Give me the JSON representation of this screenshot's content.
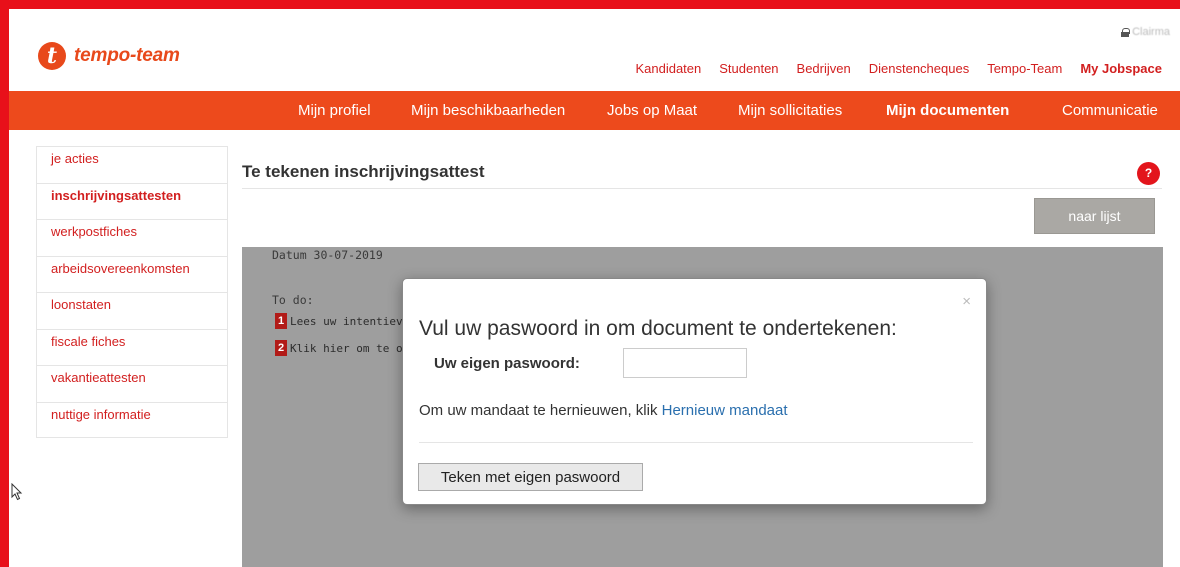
{
  "brand": {
    "logo_text": "tempo-team",
    "logo_mark": "t",
    "color": "#e8491b"
  },
  "user": {
    "name": "Clairma",
    "lock_icon": "lock-icon"
  },
  "top_nav": [
    "Kandidaten",
    "Studenten",
    "Bedrijven",
    "Dienstencheques",
    "Tempo-Team",
    "My Jobspace"
  ],
  "main_nav": [
    "Mijn profiel",
    "Mijn beschikbaarheden",
    "Jobs op Maat",
    "Mijn sollicitaties",
    "Mijn documenten",
    "Communicatie"
  ],
  "main_nav_active": "Mijn documenten",
  "sidebar": {
    "items": [
      "je acties",
      "inschrijvingsattesten",
      "werkpostfiches",
      "arbeidsovereenkomsten",
      "loonstaten",
      "fiscale fiches",
      "vakantieattesten",
      "nuttige informatie"
    ],
    "active": "inschrijvingsattesten"
  },
  "content": {
    "title": "Te tekenen inschrijvingsattest",
    "help": "?",
    "list_button": "naar lijst",
    "doc": {
      "date": "Datum 30-07-2019",
      "todo": "To do:",
      "steps": [
        {
          "num": "1",
          "text": "Lees uw intentiev"
        },
        {
          "num": "2",
          "text": "Klik hier om te on"
        }
      ]
    }
  },
  "modal": {
    "close": "×",
    "title": "Vul uw paswoord in om document te ondertekenen:",
    "password_label": "Uw eigen paswoord:",
    "renew_text": "Om uw mandaat te hernieuwen, klik ",
    "renew_link": "Hernieuw mandaat",
    "sign_button": "Teken met eigen paswoord"
  },
  "colors": {
    "accent": "#ed4a1c",
    "frame": "#e8101a",
    "link": "#d21f1f",
    "modal_link": "#2a6fae",
    "overlay": "#9e9e9e"
  }
}
